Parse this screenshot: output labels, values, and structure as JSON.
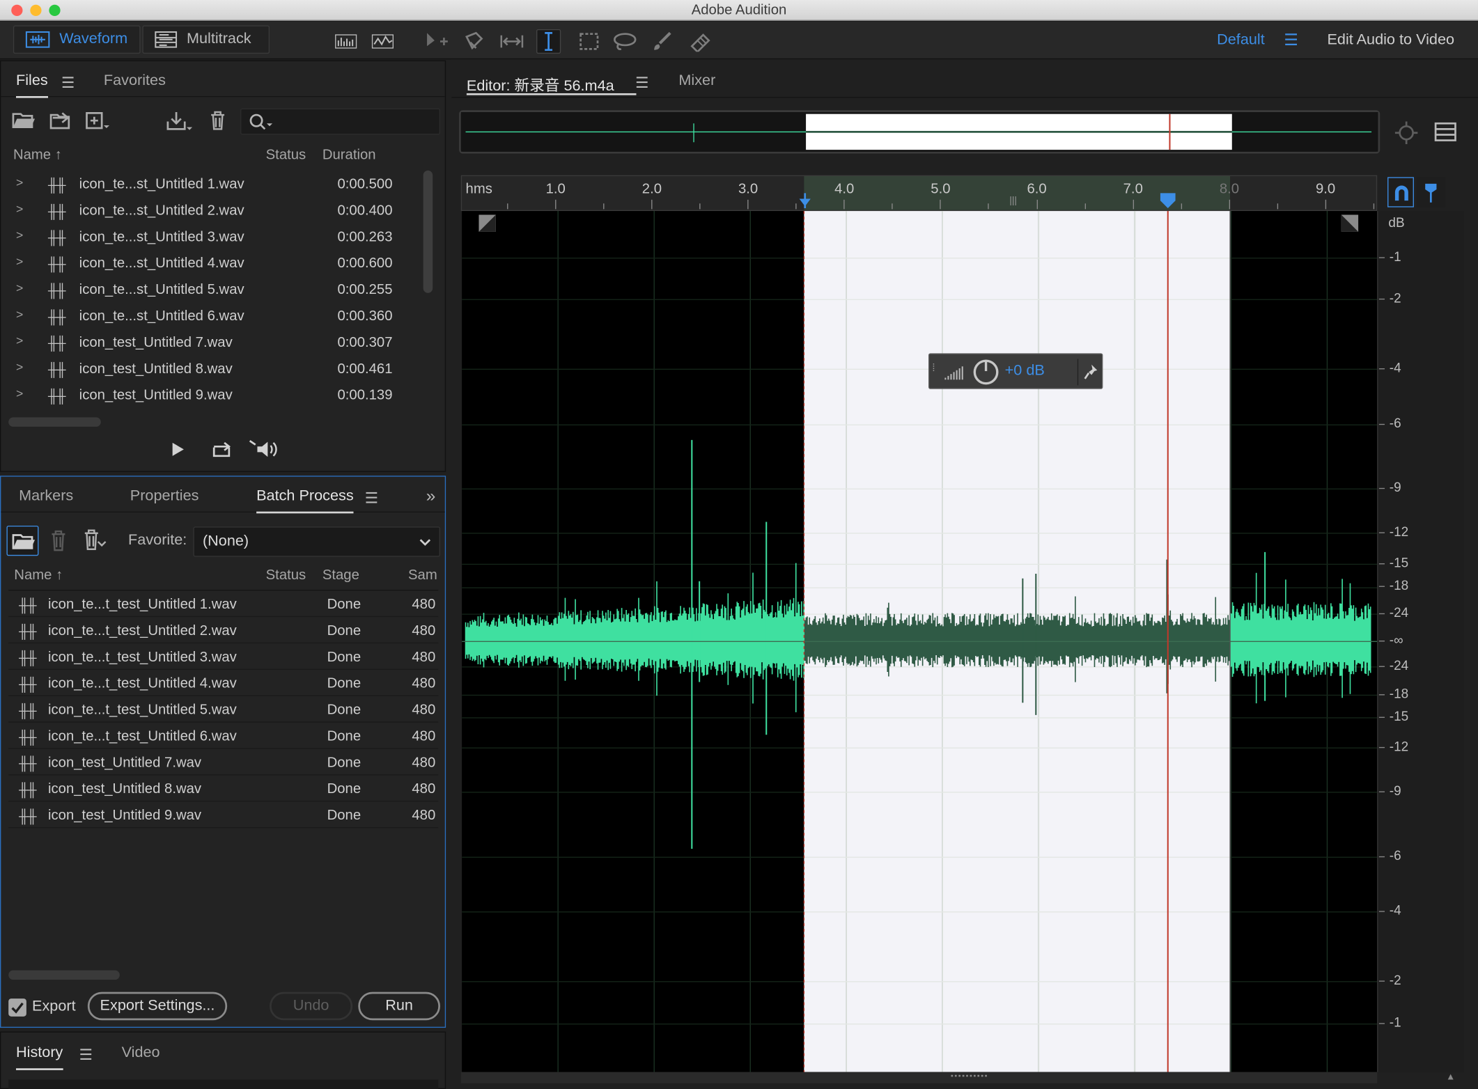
{
  "window": {
    "title": "Adobe Audition"
  },
  "toolbar": {
    "waveform_label": "Waveform",
    "multitrack_label": "Multitrack",
    "workspace_label": "Default",
    "edit_audio_to_video": "Edit Audio to Video"
  },
  "files_panel": {
    "tabs": [
      "Files",
      "Favorites"
    ],
    "columns": {
      "name": "Name",
      "status": "Status",
      "duration": "Duration"
    },
    "files": [
      {
        "name": "icon_te...st_Untitled 1.wav",
        "duration": "0:00.500"
      },
      {
        "name": "icon_te...st_Untitled 2.wav",
        "duration": "0:00.400"
      },
      {
        "name": "icon_te...st_Untitled 3.wav",
        "duration": "0:00.263"
      },
      {
        "name": "icon_te...st_Untitled 4.wav",
        "duration": "0:00.600"
      },
      {
        "name": "icon_te...st_Untitled 5.wav",
        "duration": "0:00.255"
      },
      {
        "name": "icon_te...st_Untitled 6.wav",
        "duration": "0:00.360"
      },
      {
        "name": "icon_test_Untitled 7.wav",
        "duration": "0:00.307"
      },
      {
        "name": "icon_test_Untitled 8.wav",
        "duration": "0:00.461"
      },
      {
        "name": "icon_test_Untitled 9.wav",
        "duration": "0:00.139"
      }
    ]
  },
  "batch_panel": {
    "tabs": [
      "Markers",
      "Properties",
      "Batch Process"
    ],
    "favorite_label": "Favorite:",
    "favorite_value": "(None)",
    "columns": {
      "name": "Name",
      "status": "Status",
      "stage": "Stage",
      "sample": "Sam"
    },
    "items": [
      {
        "name": "icon_te...t_test_Untitled 1.wav",
        "stage": "Done",
        "sample": "480"
      },
      {
        "name": "icon_te...t_test_Untitled 2.wav",
        "stage": "Done",
        "sample": "480"
      },
      {
        "name": "icon_te...t_test_Untitled 3.wav",
        "stage": "Done",
        "sample": "480"
      },
      {
        "name": "icon_te...t_test_Untitled 4.wav",
        "stage": "Done",
        "sample": "480"
      },
      {
        "name": "icon_te...t_test_Untitled 5.wav",
        "stage": "Done",
        "sample": "480"
      },
      {
        "name": "icon_te...t_test_Untitled 6.wav",
        "stage": "Done",
        "sample": "480"
      },
      {
        "name": "icon_test_Untitled 7.wav",
        "stage": "Done",
        "sample": "480"
      },
      {
        "name": "icon_test_Untitled 8.wav",
        "stage": "Done",
        "sample": "480"
      },
      {
        "name": "icon_test_Untitled 9.wav",
        "stage": "Done",
        "sample": "480"
      }
    ],
    "export_label": "Export",
    "export_checked": true,
    "export_settings_label": "Export Settings...",
    "undo_label": "Undo",
    "run_label": "Run"
  },
  "history_panel": {
    "tabs": [
      "History",
      "Video"
    ]
  },
  "editor": {
    "tab_label": "Editor: 新录音 56.m4a",
    "mixer_label": "Mixer",
    "time_unit": "hms",
    "time_ticks": [
      "1.0",
      "2.0",
      "3.0",
      "4.0",
      "5.0",
      "6.0",
      "7.0",
      "8.0",
      "9.0"
    ],
    "db_unit": "dB",
    "db_ticks": [
      "-1",
      "-2",
      "-4",
      "-6",
      "-9",
      "-12",
      "-15",
      "-18",
      "-24",
      "-∞",
      "-24",
      "-18",
      "-15",
      "-12",
      "-9",
      "-6",
      "-4",
      "-2",
      "-1"
    ],
    "hud_gain": "+0 dB",
    "selection_start_sec": 3.55,
    "selection_end_sec": 8.0,
    "playhead_sec": 7.35,
    "colors": {
      "accent": "#3d8ee6",
      "waveform": "#3fe0a0",
      "selected_bg": "#f3f3f8",
      "playhead": "#c0392b"
    }
  }
}
